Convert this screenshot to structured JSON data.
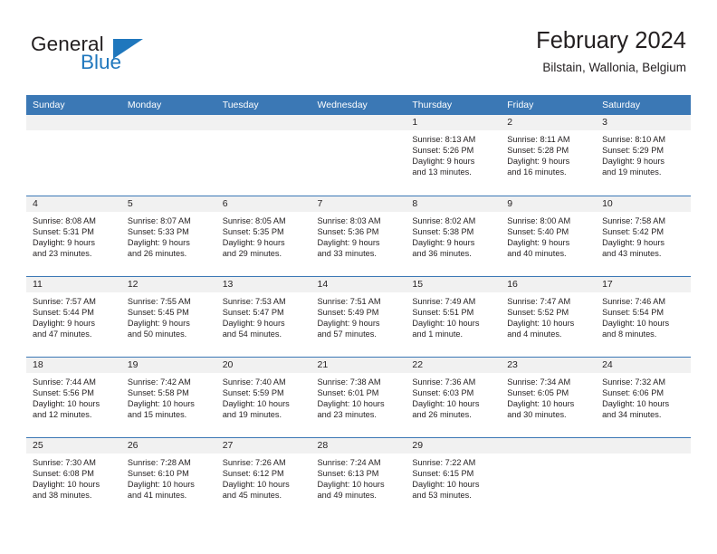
{
  "logo": {
    "word_top": "General",
    "word_bottom": "Blue",
    "accent_color": "#1f77bd",
    "text_color": "#231f20"
  },
  "header": {
    "title": "February 2024",
    "subtitle": "Bilstain, Wallonia, Belgium"
  },
  "theme": {
    "header_blue": "#3b78b5",
    "day_band_gray": "#f1f1f1",
    "text": "#231f20",
    "background": "#ffffff"
  },
  "calendar": {
    "weekday_headers": [
      "Sunday",
      "Monday",
      "Tuesday",
      "Wednesday",
      "Thursday",
      "Friday",
      "Saturday"
    ],
    "weeks": [
      [
        {
          "day": "",
          "empty": true
        },
        {
          "day": "",
          "empty": true
        },
        {
          "day": "",
          "empty": true
        },
        {
          "day": "",
          "empty": true
        },
        {
          "day": "1",
          "sunrise": "Sunrise: 8:13 AM",
          "sunset": "Sunset: 5:26 PM",
          "daylight1": "Daylight: 9 hours",
          "daylight2": "and 13 minutes."
        },
        {
          "day": "2",
          "sunrise": "Sunrise: 8:11 AM",
          "sunset": "Sunset: 5:28 PM",
          "daylight1": "Daylight: 9 hours",
          "daylight2": "and 16 minutes."
        },
        {
          "day": "3",
          "sunrise": "Sunrise: 8:10 AM",
          "sunset": "Sunset: 5:29 PM",
          "daylight1": "Daylight: 9 hours",
          "daylight2": "and 19 minutes."
        }
      ],
      [
        {
          "day": "4",
          "sunrise": "Sunrise: 8:08 AM",
          "sunset": "Sunset: 5:31 PM",
          "daylight1": "Daylight: 9 hours",
          "daylight2": "and 23 minutes."
        },
        {
          "day": "5",
          "sunrise": "Sunrise: 8:07 AM",
          "sunset": "Sunset: 5:33 PM",
          "daylight1": "Daylight: 9 hours",
          "daylight2": "and 26 minutes."
        },
        {
          "day": "6",
          "sunrise": "Sunrise: 8:05 AM",
          "sunset": "Sunset: 5:35 PM",
          "daylight1": "Daylight: 9 hours",
          "daylight2": "and 29 minutes."
        },
        {
          "day": "7",
          "sunrise": "Sunrise: 8:03 AM",
          "sunset": "Sunset: 5:36 PM",
          "daylight1": "Daylight: 9 hours",
          "daylight2": "and 33 minutes."
        },
        {
          "day": "8",
          "sunrise": "Sunrise: 8:02 AM",
          "sunset": "Sunset: 5:38 PM",
          "daylight1": "Daylight: 9 hours",
          "daylight2": "and 36 minutes."
        },
        {
          "day": "9",
          "sunrise": "Sunrise: 8:00 AM",
          "sunset": "Sunset: 5:40 PM",
          "daylight1": "Daylight: 9 hours",
          "daylight2": "and 40 minutes."
        },
        {
          "day": "10",
          "sunrise": "Sunrise: 7:58 AM",
          "sunset": "Sunset: 5:42 PM",
          "daylight1": "Daylight: 9 hours",
          "daylight2": "and 43 minutes."
        }
      ],
      [
        {
          "day": "11",
          "sunrise": "Sunrise: 7:57 AM",
          "sunset": "Sunset: 5:44 PM",
          "daylight1": "Daylight: 9 hours",
          "daylight2": "and 47 minutes."
        },
        {
          "day": "12",
          "sunrise": "Sunrise: 7:55 AM",
          "sunset": "Sunset: 5:45 PM",
          "daylight1": "Daylight: 9 hours",
          "daylight2": "and 50 minutes."
        },
        {
          "day": "13",
          "sunrise": "Sunrise: 7:53 AM",
          "sunset": "Sunset: 5:47 PM",
          "daylight1": "Daylight: 9 hours",
          "daylight2": "and 54 minutes."
        },
        {
          "day": "14",
          "sunrise": "Sunrise: 7:51 AM",
          "sunset": "Sunset: 5:49 PM",
          "daylight1": "Daylight: 9 hours",
          "daylight2": "and 57 minutes."
        },
        {
          "day": "15",
          "sunrise": "Sunrise: 7:49 AM",
          "sunset": "Sunset: 5:51 PM",
          "daylight1": "Daylight: 10 hours",
          "daylight2": "and 1 minute."
        },
        {
          "day": "16",
          "sunrise": "Sunrise: 7:47 AM",
          "sunset": "Sunset: 5:52 PM",
          "daylight1": "Daylight: 10 hours",
          "daylight2": "and 4 minutes."
        },
        {
          "day": "17",
          "sunrise": "Sunrise: 7:46 AM",
          "sunset": "Sunset: 5:54 PM",
          "daylight1": "Daylight: 10 hours",
          "daylight2": "and 8 minutes."
        }
      ],
      [
        {
          "day": "18",
          "sunrise": "Sunrise: 7:44 AM",
          "sunset": "Sunset: 5:56 PM",
          "daylight1": "Daylight: 10 hours",
          "daylight2": "and 12 minutes."
        },
        {
          "day": "19",
          "sunrise": "Sunrise: 7:42 AM",
          "sunset": "Sunset: 5:58 PM",
          "daylight1": "Daylight: 10 hours",
          "daylight2": "and 15 minutes."
        },
        {
          "day": "20",
          "sunrise": "Sunrise: 7:40 AM",
          "sunset": "Sunset: 5:59 PM",
          "daylight1": "Daylight: 10 hours",
          "daylight2": "and 19 minutes."
        },
        {
          "day": "21",
          "sunrise": "Sunrise: 7:38 AM",
          "sunset": "Sunset: 6:01 PM",
          "daylight1": "Daylight: 10 hours",
          "daylight2": "and 23 minutes."
        },
        {
          "day": "22",
          "sunrise": "Sunrise: 7:36 AM",
          "sunset": "Sunset: 6:03 PM",
          "daylight1": "Daylight: 10 hours",
          "daylight2": "and 26 minutes."
        },
        {
          "day": "23",
          "sunrise": "Sunrise: 7:34 AM",
          "sunset": "Sunset: 6:05 PM",
          "daylight1": "Daylight: 10 hours",
          "daylight2": "and 30 minutes."
        },
        {
          "day": "24",
          "sunrise": "Sunrise: 7:32 AM",
          "sunset": "Sunset: 6:06 PM",
          "daylight1": "Daylight: 10 hours",
          "daylight2": "and 34 minutes."
        }
      ],
      [
        {
          "day": "25",
          "sunrise": "Sunrise: 7:30 AM",
          "sunset": "Sunset: 6:08 PM",
          "daylight1": "Daylight: 10 hours",
          "daylight2": "and 38 minutes."
        },
        {
          "day": "26",
          "sunrise": "Sunrise: 7:28 AM",
          "sunset": "Sunset: 6:10 PM",
          "daylight1": "Daylight: 10 hours",
          "daylight2": "and 41 minutes."
        },
        {
          "day": "27",
          "sunrise": "Sunrise: 7:26 AM",
          "sunset": "Sunset: 6:12 PM",
          "daylight1": "Daylight: 10 hours",
          "daylight2": "and 45 minutes."
        },
        {
          "day": "28",
          "sunrise": "Sunrise: 7:24 AM",
          "sunset": "Sunset: 6:13 PM",
          "daylight1": "Daylight: 10 hours",
          "daylight2": "and 49 minutes."
        },
        {
          "day": "29",
          "sunrise": "Sunrise: 7:22 AM",
          "sunset": "Sunset: 6:15 PM",
          "daylight1": "Daylight: 10 hours",
          "daylight2": "and 53 minutes."
        },
        {
          "day": "",
          "empty": true
        },
        {
          "day": "",
          "empty": true
        }
      ]
    ]
  }
}
